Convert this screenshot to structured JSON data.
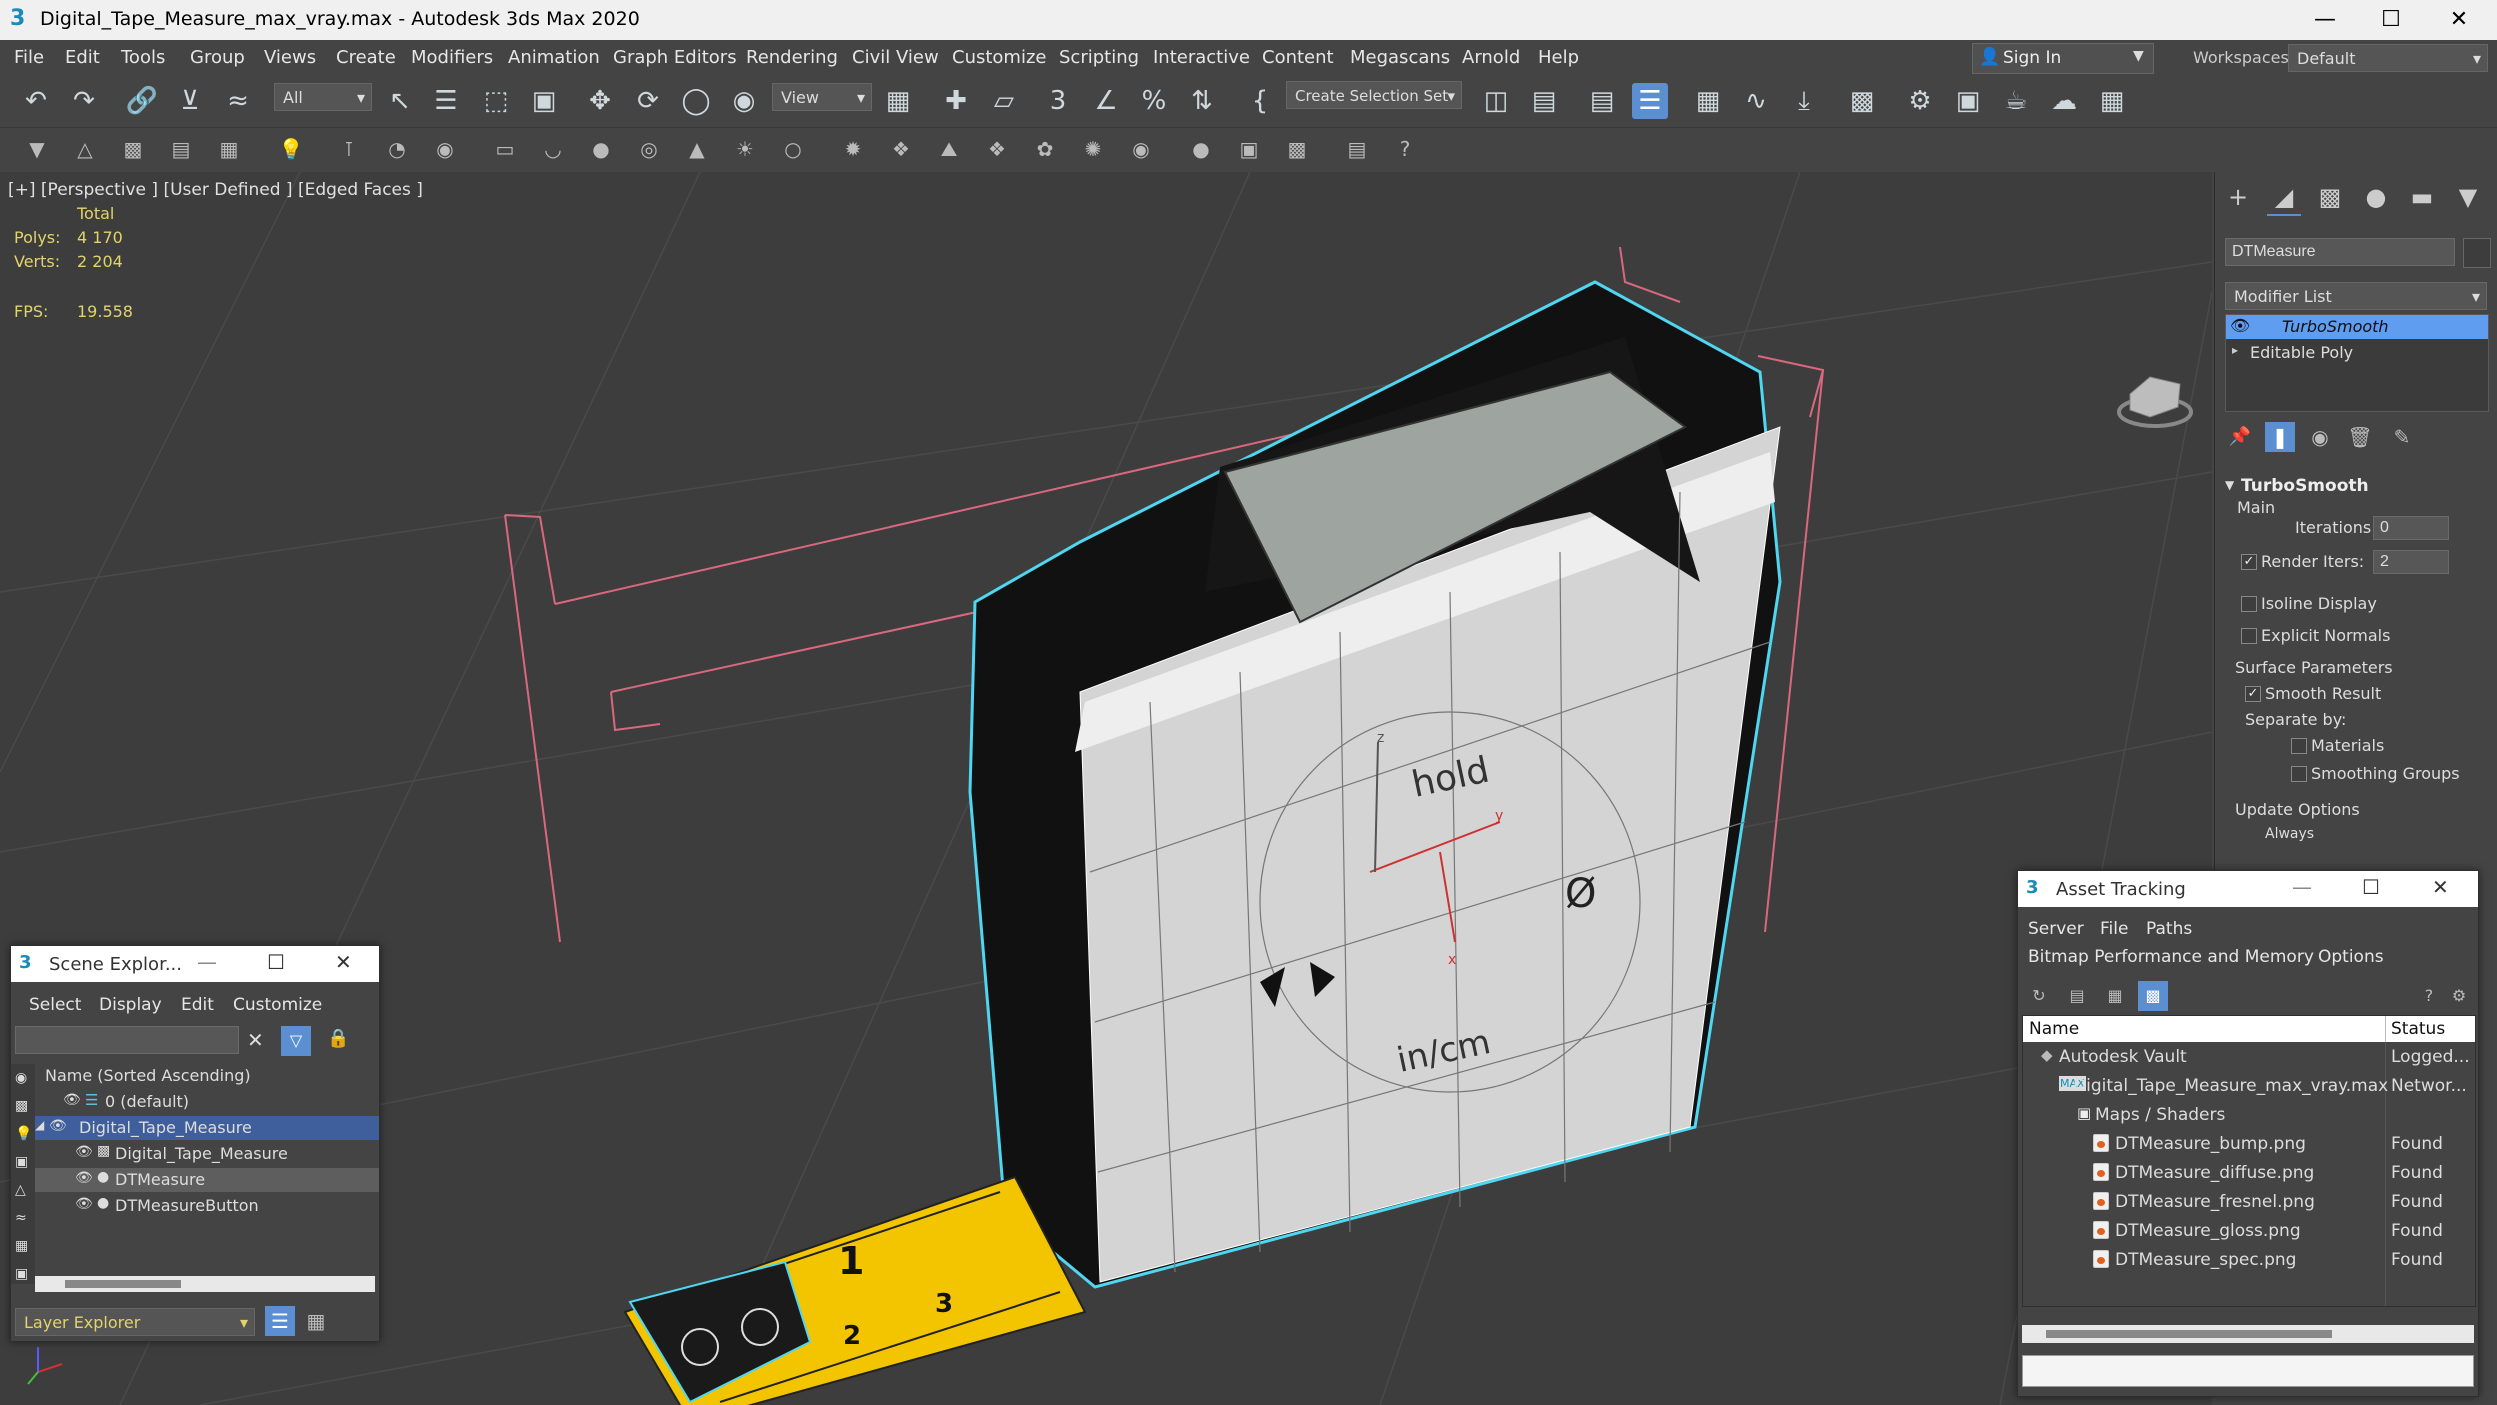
{
  "window": {
    "title": "Digital_Tape_Measure_max_vray.max - Autodesk 3ds Max 2020",
    "app_icon": "3"
  },
  "menu": [
    "File",
    "Edit",
    "Tools",
    "Group",
    "Views",
    "Create",
    "Modifiers",
    "Animation",
    "Graph Editors",
    "Rendering",
    "Civil View",
    "Customize",
    "Scripting",
    "Interactive",
    "Content",
    "Megascans",
    "Arnold",
    "Help"
  ],
  "signin": "Sign In",
  "workspaces": {
    "label": "Workspaces:",
    "value": "Default"
  },
  "toolbar": {
    "filter_value": "All",
    "view_value": "View",
    "selection_set_placeholder": "Create Selection Set"
  },
  "viewport": {
    "label": "[+] [Perspective ] [User Defined ] [Edged Faces ]",
    "stats": {
      "total": "Total",
      "polys_label": "Polys:",
      "polys": "4 170",
      "verts_label": "Verts:",
      "verts": "2 204",
      "fps_label": "FPS:",
      "fps": "19.558"
    },
    "device_text": {
      "hold": "hold",
      "unit": "in/cm",
      "zero": "Ø",
      "ruler1": "1",
      "ruler2": "2",
      "ruler3": "3"
    },
    "axes": {
      "x": "x",
      "y": "y",
      "z": "z"
    }
  },
  "command_panel": {
    "object_name": "DTMeasure",
    "modifier_list": "Modifier List",
    "stack": [
      "TurboSmooth",
      "Editable Poly"
    ],
    "rollout_title": "TurboSmooth",
    "main_label": "Main",
    "iterations_label": "Iterations:",
    "iterations": "0",
    "render_iters_label": "Render Iters:",
    "render_iters": "2",
    "isoline": "Isoline Display",
    "explicit_normals": "Explicit Normals",
    "surface_params": "Surface Parameters",
    "smooth_result": "Smooth Result",
    "separate_by": "Separate by:",
    "materials": "Materials",
    "smoothing_groups": "Smoothing Groups",
    "update_options": "Update Options",
    "always": "Always"
  },
  "scene_explorer": {
    "title": "Scene Explor...",
    "menu": [
      "Select",
      "Display",
      "Edit",
      "Customize"
    ],
    "header": "Name (Sorted Ascending)",
    "rows": [
      "0 (default)",
      "Digital_Tape_Measure",
      "Digital_Tape_Measure",
      "DTMeasure",
      "DTMeasureButton"
    ],
    "footer_value": "Layer Explorer"
  },
  "asset_tracking": {
    "title": "Asset Tracking",
    "menu": [
      "Server",
      "File",
      "Paths"
    ],
    "menu2": [
      "Bitmap Performance and Memory",
      "Options"
    ],
    "col_name": "Name",
    "col_status": "Status",
    "rows": [
      {
        "name": "Autodesk Vault",
        "status": "Logged..."
      },
      {
        "name": "Digital_Tape_Measure_max_vray.max",
        "status": "Networ..."
      },
      {
        "name": "Maps / Shaders",
        "status": ""
      },
      {
        "name": "DTMeasure_bump.png",
        "status": "Found"
      },
      {
        "name": "DTMeasure_diffuse.png",
        "status": "Found"
      },
      {
        "name": "DTMeasure_fresnel.png",
        "status": "Found"
      },
      {
        "name": "DTMeasure_gloss.png",
        "status": "Found"
      },
      {
        "name": "DTMeasure_spec.png",
        "status": "Found"
      }
    ]
  },
  "colors": {
    "accent": "#5b8fd2",
    "selection": "#5e9df0",
    "stat_text": "#e3d36b",
    "tape_yellow": "#f2c500",
    "outline_cyan": "#4fd6f0"
  }
}
